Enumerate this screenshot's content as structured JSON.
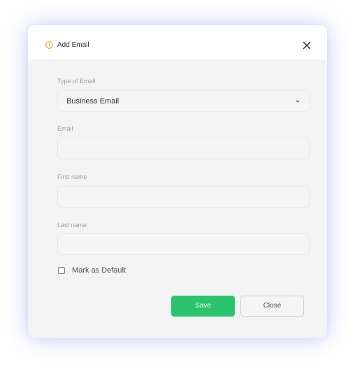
{
  "dialog": {
    "title": "Add Email",
    "fields": {
      "type": {
        "label": "Type of Email",
        "value": "Business Email"
      },
      "email": {
        "label": "Email",
        "value": ""
      },
      "first_name": {
        "label": "First name",
        "value": ""
      },
      "last_name": {
        "label": "Last name",
        "value": ""
      }
    },
    "default_checkbox": {
      "label": "Mark as Default",
      "checked": false
    },
    "buttons": {
      "save": "Save",
      "close": "Close"
    }
  },
  "icons": {
    "header": "warning-circle-icon",
    "close": "close-icon",
    "dropdown": "chevron-down-icon"
  },
  "colors": {
    "accent_save": "#2bc46d",
    "warning_icon": "#f0a020",
    "glow": "#5c6ef5"
  }
}
